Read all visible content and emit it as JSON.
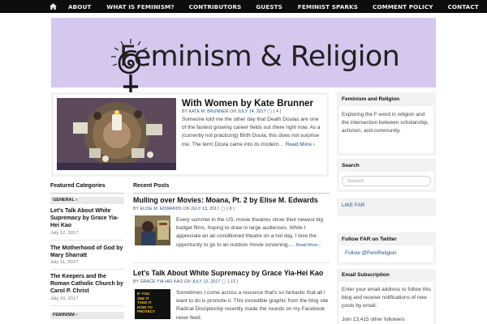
{
  "nav": {
    "items": [
      "ABOUT",
      "WHAT IS FEMINISM?",
      "CONTRIBUTORS",
      "GUESTS",
      "FEMINIST SPARKS",
      "COMMENT POLICY",
      "CONTACT"
    ]
  },
  "banner": {
    "title": "Feminism & Religion"
  },
  "featured": {
    "title": "With Women by Kate Brunner",
    "by_label": "by",
    "author": "KATE M. BRUNNER",
    "on_label": "on",
    "date": "JULY 14, 2017",
    "comments": "( 4 )",
    "excerpt": "Someone told me the other day that Death Doulas are one of the fastest growing career fields out there right now. As a (currently not practicing) Birth Doula, this does not surprise me. The term Doula came into its modern…",
    "read_more": "Read More ›"
  },
  "featured_categories": {
    "heading": "Featured Categories",
    "general_label": "GENERAL ›",
    "feminism_label": "FEMINISM ›",
    "posts": [
      {
        "title": "Let's Talk About White Supremacy by Grace Yia-Hei Kao",
        "date": "July 12, 2017"
      },
      {
        "title": "The Motherhood of God by Mary Sharratt",
        "date": "July 11, 2017"
      },
      {
        "title": "The Keepers and the Roman Catholic Church by Carol P. Christ",
        "date": "July 10, 2017"
      }
    ]
  },
  "recent_posts": {
    "heading": "Recent Posts",
    "posts": [
      {
        "title": "Mulling over Movies: Moana, Pt. 2 by Elise M. Edwards",
        "author": "ELISE M. EDWARDS",
        "date": "JULY 13, 2017",
        "comments": "( 8 )",
        "excerpt": "Every summer in the US, movie theatres show their newest big budget films, hoping to draw in large audiences. While I appreciate an air-conditioned theatre on a hot day, I love the opportunity to go to an outdoor movie screening.…",
        "read_more": "Read More ›"
      },
      {
        "title": "Let's Talk About White Supremacy by Grace Yia-Hei Kao",
        "author": "GRACE YIA-HEI KAO",
        "date": "JULY 12, 2017",
        "comments": "( 13 )",
        "excerpt": "Sometimes I come across a resource that's so fantastic that all I want to do is promote it. This incredible graphic from the blog site Radical Discipleship recently made the rounds on my Facebook news feed.",
        "image_text": [
          "IF YOU",
          "SEE IT",
          "TAKE IT",
          "HOW TO",
          "PROTECT"
        ]
      }
    ],
    "by_label": "by",
    "on_label": "on"
  },
  "sidebar": {
    "about_title": "Feminism and Religion",
    "about_text": "Exploring the F-word in religion and the intersection between scholarship, activism, and community.",
    "search_title": "Search",
    "search_placeholder": "Search",
    "like_link": "LIKE FAR",
    "twitter_title": "Follow FAR on Twitter",
    "twitter_link": "Follow @FemReligion",
    "email_title": "Email Subscription",
    "email_text": "Enter your email address to follow this blog and receive notifications of new posts by email.",
    "followers": "Join 13,415 other followers"
  }
}
